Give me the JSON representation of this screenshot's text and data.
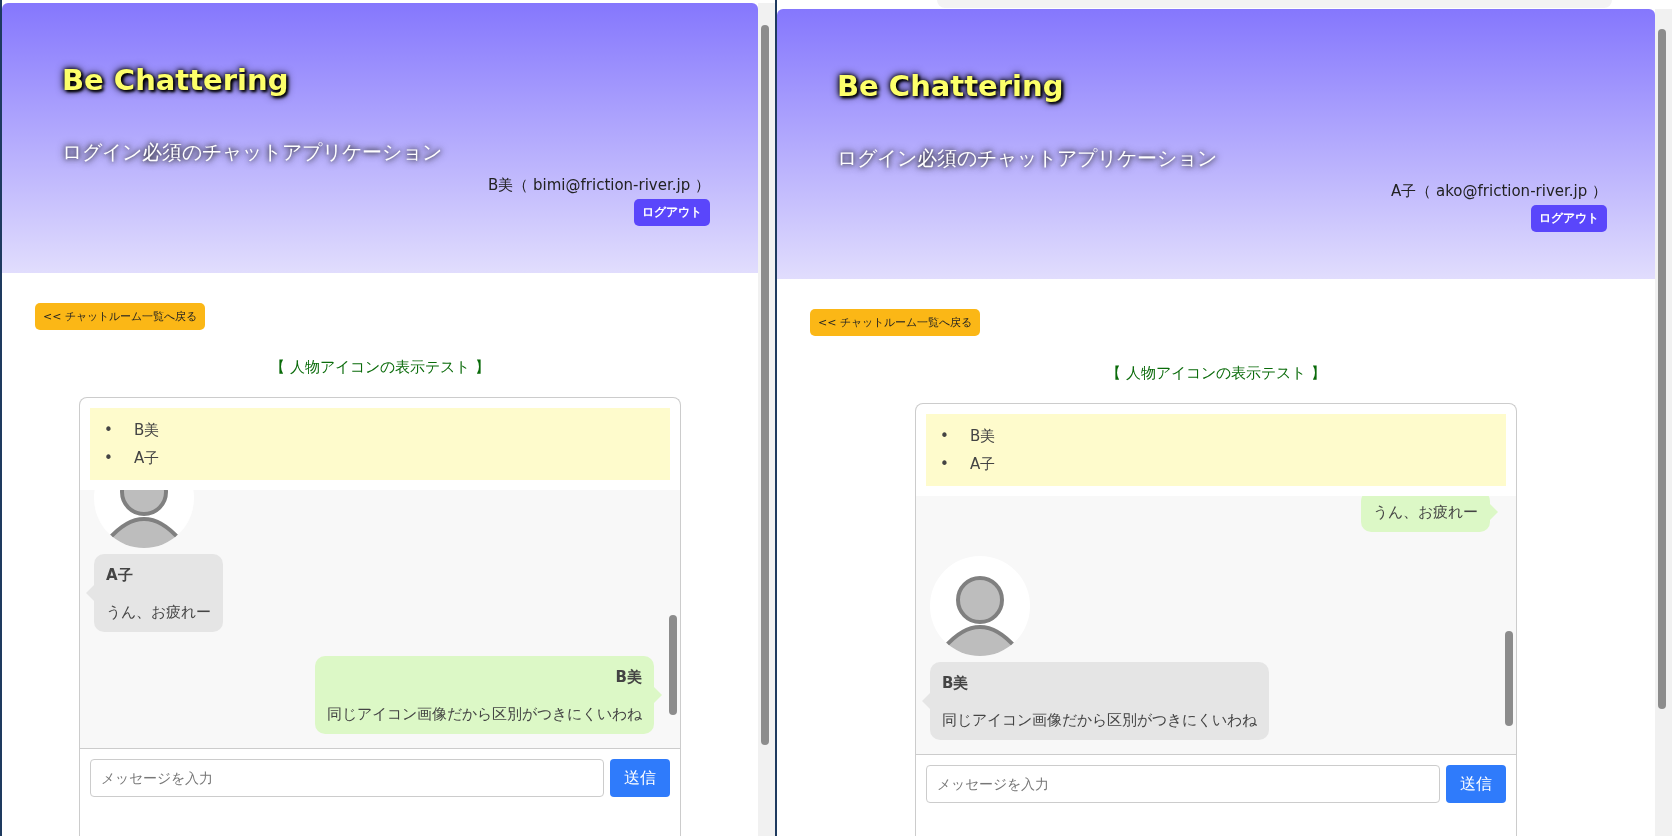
{
  "panes": [
    {
      "header": {
        "title": "Be Chattering",
        "subtitle": "ログイン必須のチャットアプリケーション",
        "user": "B美（ bimi@friction-river.jp ）",
        "logout": "ログアウト"
      },
      "back_button": "<< チャットルーム一覧へ戻る",
      "room_title": "【 人物アイコンの表示テスト 】",
      "members": [
        {
          "bullet": "•",
          "name": "B美"
        },
        {
          "bullet": "•",
          "name": "A子"
        }
      ],
      "messages": [
        {
          "kind": "other",
          "name": "A子",
          "text": "うん、お疲れー"
        },
        {
          "kind": "mine",
          "name": "B美",
          "text": "同じアイコン画像だから区別がつきにくいわね"
        }
      ],
      "input": {
        "placeholder": "メッセージを入力"
      },
      "send_button": "送信"
    },
    {
      "header": {
        "title": "Be Chattering",
        "subtitle": "ログイン必須のチャットアプリケーション",
        "user": "A子（ ako@friction-river.jp ）",
        "logout": "ログアウト"
      },
      "back_button": "<< チャットルーム一覧へ戻る",
      "room_title": "【 人物アイコンの表示テスト 】",
      "members": [
        {
          "bullet": "•",
          "name": "B美"
        },
        {
          "bullet": "•",
          "name": "A子"
        }
      ],
      "messages": [
        {
          "kind": "mine",
          "text": "うん、お疲れー"
        },
        {
          "kind": "other",
          "name": "B美",
          "text": "同じアイコン画像だから区別がつきにくいわね"
        }
      ],
      "input": {
        "placeholder": "メッセージを入力"
      },
      "send_button": "送信"
    }
  ]
}
